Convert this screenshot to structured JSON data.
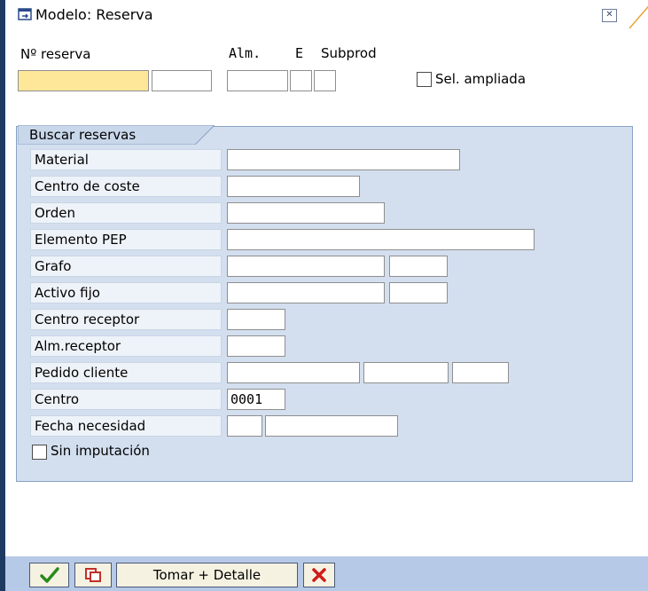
{
  "window": {
    "title": "Modelo: Reserva"
  },
  "header": {
    "reserva_label": "Nº reserva",
    "alm_label": "Alm.",
    "e_label": "E",
    "subprod_label": "Subprod",
    "sel_ampliada_label": "Sel. ampliada"
  },
  "group": {
    "title": "Buscar reservas",
    "rows": [
      {
        "label": "Material"
      },
      {
        "label": "Centro de coste"
      },
      {
        "label": "Orden"
      },
      {
        "label": "Elemento PEP"
      },
      {
        "label": "Grafo"
      },
      {
        "label": "Activo fijo"
      },
      {
        "label": "Centro receptor"
      },
      {
        "label": "Alm.receptor"
      },
      {
        "label": "Pedido cliente"
      },
      {
        "label": "Centro",
        "value": "0001"
      },
      {
        "label": "Fecha necesidad"
      }
    ],
    "sin_imputacion_label": "Sin imputación"
  },
  "footer": {
    "tomar_detalle_label": "Tomar + Detalle"
  },
  "colors": {
    "group_bg": "#d3dfef",
    "footer_bg": "#b6c9e6",
    "required_field": "#ffe79a",
    "confirm_green": "#2a8a1a",
    "cancel_red": "#d11a1a"
  },
  "icons": [
    "window-icon",
    "close-icon",
    "confirm-check-icon",
    "copy-icon",
    "cancel-x-icon"
  ]
}
